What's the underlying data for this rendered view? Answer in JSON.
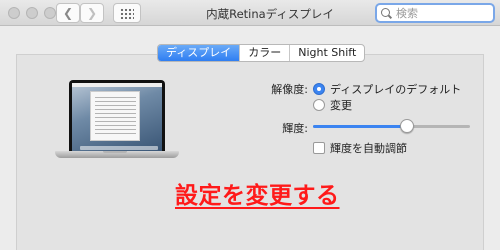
{
  "window": {
    "title": "内蔵Retinaディスプレイ",
    "search_placeholder": "検索"
  },
  "tabs": [
    {
      "label": "ディスプレイ",
      "active": true
    },
    {
      "label": "カラー",
      "active": false
    },
    {
      "label": "Night Shift",
      "active": false
    }
  ],
  "display": {
    "resolution_label": "解像度:",
    "resolution_options": [
      {
        "label": "ディスプレイのデフォルト",
        "selected": true
      },
      {
        "label": "変更",
        "selected": false
      }
    ],
    "brightness_label": "輝度:",
    "brightness_level": 0.6,
    "auto_brightness_label": "輝度を自動調節",
    "auto_brightness_checked": false
  },
  "annotation": {
    "text": "設定を変更する",
    "color": "#ff1a1a"
  },
  "colors": {
    "accent": "#3b84f1"
  }
}
